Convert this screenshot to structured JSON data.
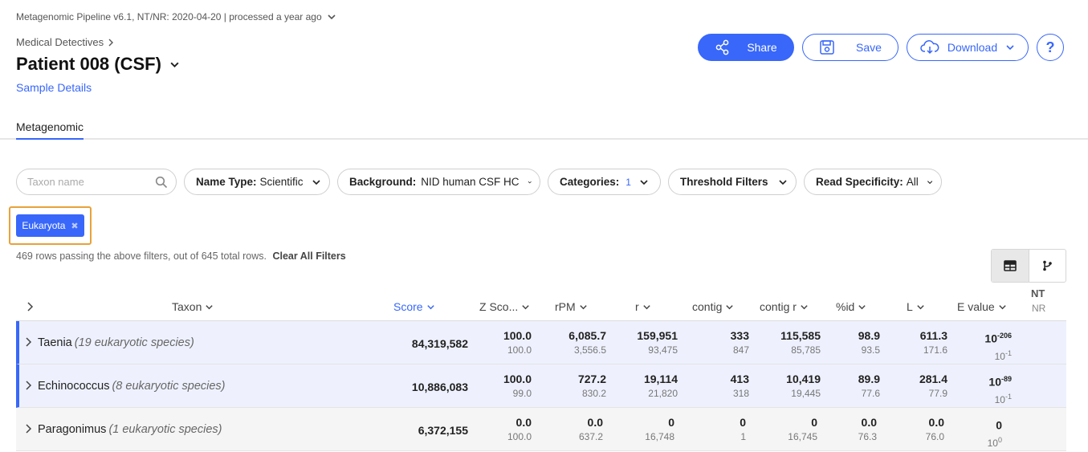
{
  "header": {
    "pipeline": "Metagenomic Pipeline v6.1, NT/NR: 2020-04-20 | processed a year ago",
    "breadcrumb": "Medical Detectives",
    "title": "Patient 008 (CSF)",
    "sample_details": "Sample Details"
  },
  "actions": {
    "share": "Share",
    "save": "Save",
    "download": "Download",
    "help": "?"
  },
  "tabs": {
    "metagenomic": "Metagenomic"
  },
  "filters": {
    "search_placeholder": "Taxon name",
    "name_type_label": "Name Type:",
    "name_type_value": "Scientific",
    "background_label": "Background:",
    "background_value": "NID human CSF HC",
    "categories_label": "Categories:",
    "categories_count": "1",
    "threshold_label": "Threshold Filters",
    "read_spec_label": "Read Specificity:",
    "read_spec_value": "All"
  },
  "active_filter_chip": "Eukaryota",
  "rows_info": {
    "text": "469 rows passing the above filters, out of 645 total rows.",
    "clear": "Clear All Filters"
  },
  "table": {
    "headers": {
      "taxon": "Taxon",
      "score": "Score",
      "zscore": "Z Sco...",
      "rpm": "rPM",
      "r": "r",
      "contig": "contig",
      "contig_r": "contig r",
      "pct_id": "%id",
      "l": "L",
      "evalue": "E value",
      "nt": "NT",
      "nr": "NR"
    },
    "rows": [
      {
        "name": "Taenia",
        "sub": "(19 eukaryotic species)",
        "score": "84,319,582",
        "z": [
          "100.0",
          "100.0"
        ],
        "rpm": [
          "6,085.7",
          "3,556.5"
        ],
        "r": [
          "159,951",
          "93,475"
        ],
        "contig": [
          "333",
          "847"
        ],
        "contig_r": [
          "115,585",
          "85,785"
        ],
        "pct_id": [
          "98.9",
          "93.5"
        ],
        "l": [
          "611.3",
          "171.6"
        ],
        "e_base": [
          "10",
          "10"
        ],
        "e_exp": [
          "-206",
          "-1"
        ]
      },
      {
        "name": "Echinococcus",
        "sub": "(8 eukaryotic species)",
        "score": "10,886,083",
        "z": [
          "100.0",
          "99.0"
        ],
        "rpm": [
          "727.2",
          "830.2"
        ],
        "r": [
          "19,114",
          "21,820"
        ],
        "contig": [
          "413",
          "318"
        ],
        "contig_r": [
          "10,419",
          "19,445"
        ],
        "pct_id": [
          "89.9",
          "77.6"
        ],
        "l": [
          "281.4",
          "77.9"
        ],
        "e_base": [
          "10",
          "10"
        ],
        "e_exp": [
          "-89",
          "-1"
        ]
      },
      {
        "name": "Paragonimus",
        "sub": "(1 eukaryotic species)",
        "score": "6,372,155",
        "z": [
          "0.0",
          "100.0"
        ],
        "rpm": [
          "0.0",
          "637.2"
        ],
        "r": [
          "0",
          "16,748"
        ],
        "contig": [
          "0",
          "1"
        ],
        "contig_r": [
          "0",
          "16,745"
        ],
        "pct_id": [
          "0.0",
          "76.3"
        ],
        "l": [
          "0.0",
          "76.0"
        ],
        "e_base": [
          "0",
          "10"
        ],
        "e_exp": [
          "",
          "0"
        ]
      }
    ]
  },
  "colors": {
    "accent": "#3867fa",
    "highlight": "#e8a23a"
  },
  "icons": [
    "chevron-down-icon",
    "chevron-right-icon",
    "share-icon",
    "save-icon",
    "cloud-download-icon",
    "search-icon",
    "close-icon",
    "table-view-icon",
    "tree-view-icon"
  ]
}
